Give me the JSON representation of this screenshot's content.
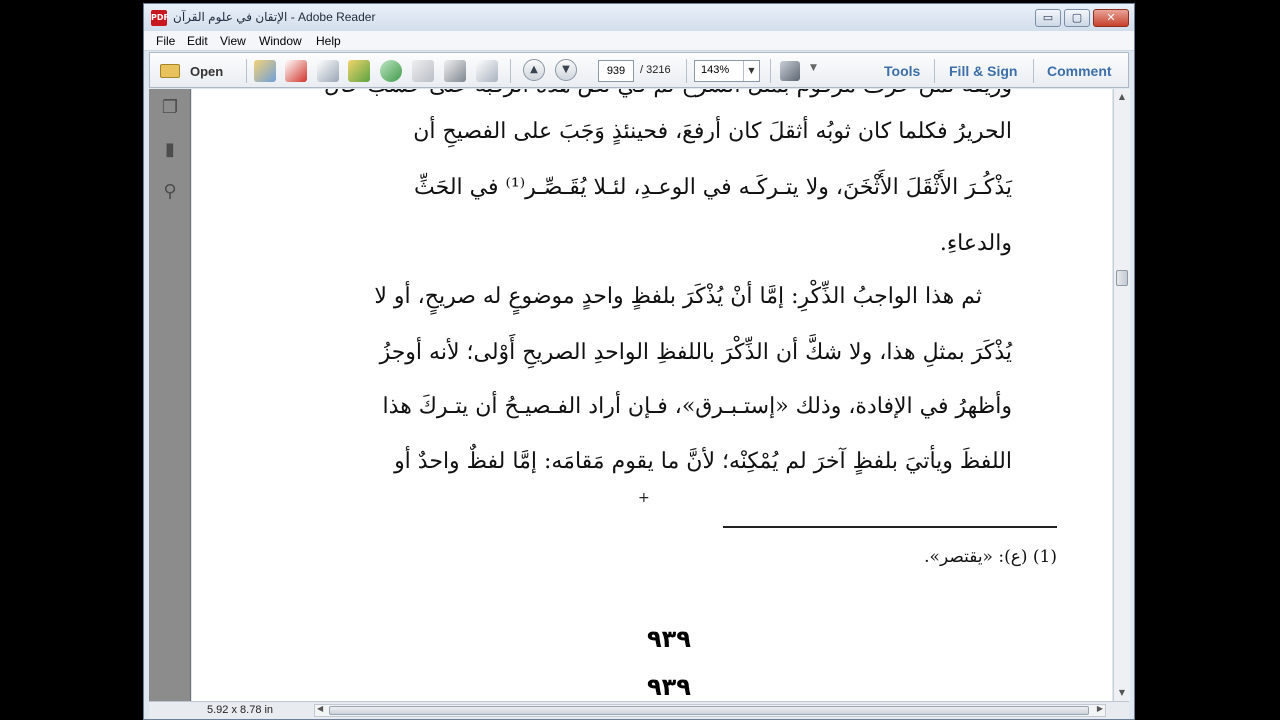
{
  "window": {
    "title": "الإتقان في علوم القرآن - Adobe Reader",
    "controls": {
      "minimize": "▭",
      "maximize": "▢",
      "close": "✕"
    }
  },
  "menu": [
    "File",
    "Edit",
    "View",
    "Window",
    "Help"
  ],
  "toolbar": {
    "open_label": "Open",
    "page_current": "939",
    "page_total": "/ 3216",
    "zoom": "143%",
    "right_tools": [
      "Tools",
      "Fill & Sign",
      "Comment"
    ]
  },
  "document": {
    "lines": [
      "وريقة لمن حرف مرقوم بمثل الشرح لم في نص هذه الرقبة على حسب حال",
      "الحريرُ فكلما كان ثوبُه أثقلَ كان أرفعَ، فحينئذٍ وَجَبَ على الفصيحِ أن",
      "يَذْكُـرَ الأَثْقَلَ الأَثْخَنَ، ولا يتـركَـه في الوعـدِ، لئـلا يُقَـصِّـر⁽¹⁾ في الحَثِّ",
      "والدعاءِ.",
      "ثم هذا الواجبُ الذِّكْرِ: إمَّا أنْ يُذْكَرَ بلفظٍ واحدٍ موضوعٍ له صريحٍ، أو لا",
      "يُذْكَرَ بمثلِ هذا، ولا شكَّ أن الذِّكْرَ باللفظِ الواحدِ الصريحِ أَوْلى؛ لأنه أوجزُ",
      "وأظهرُ في الإفادة، وذلك «إستـبـرق»، فـإن أراد الفـصيـحُ أن يتـركَ هذا",
      "اللفظَ ويأتيَ بلفظٍ آخرَ لم يُمْكِنْه؛ لأنَّ ما يقوم مَقامَه: إمَّا لفظٌ واحدٌ أو"
    ],
    "footnote": "(1) (ع): «يقتصر».",
    "page_numbers": [
      "٩٣٩",
      "٩٣٩"
    ]
  },
  "status": {
    "page_size": "5.92 x 8.78 in"
  }
}
